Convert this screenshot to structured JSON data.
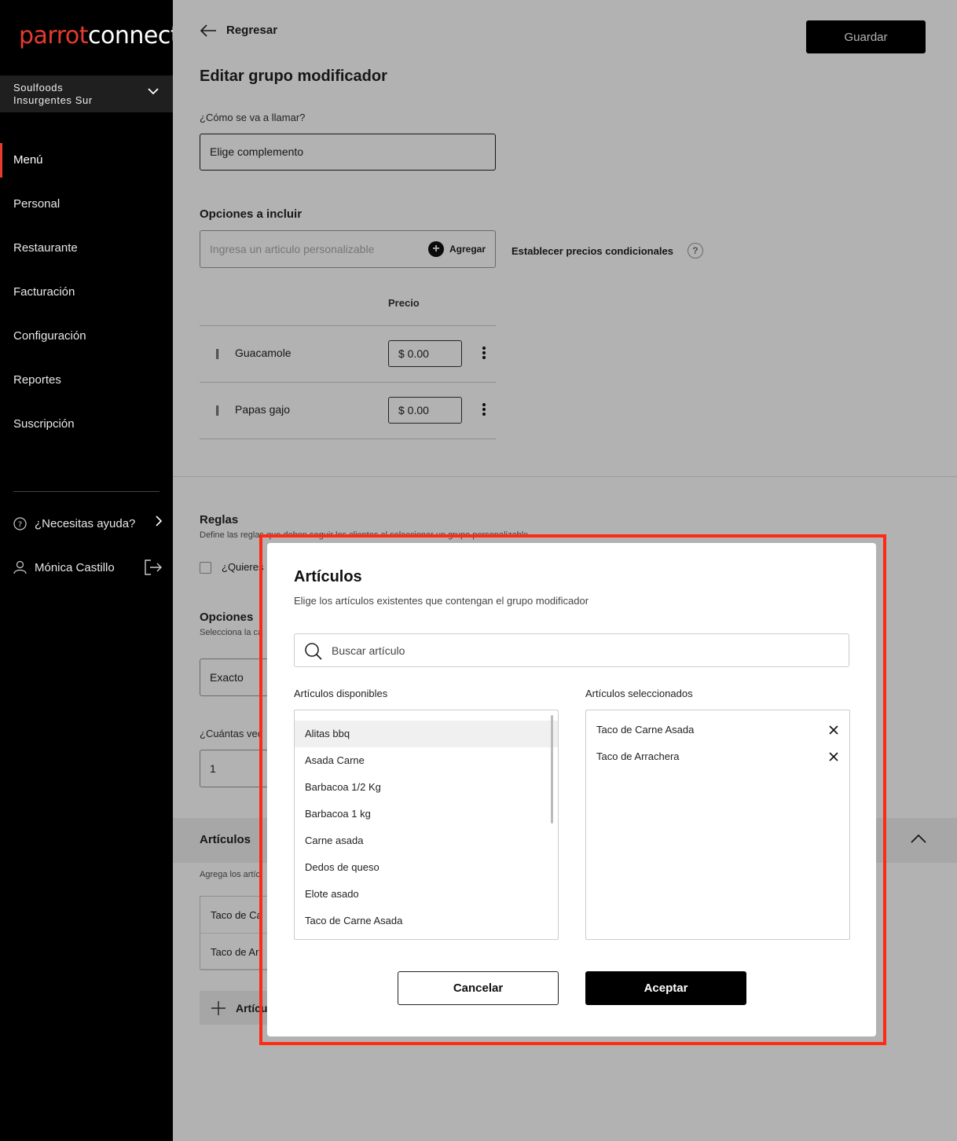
{
  "brand": {
    "part1": "parrot",
    "part2": "connect",
    "color": "#e63b2e"
  },
  "store": {
    "line1": "Soulfoods",
    "line2": "Insurgentes Sur"
  },
  "nav": {
    "items": [
      {
        "label": "Menú",
        "active": true
      },
      {
        "label": "Personal"
      },
      {
        "label": "Restaurante"
      },
      {
        "label": "Facturación"
      },
      {
        "label": "Configuración"
      },
      {
        "label": "Reportes"
      },
      {
        "label": "Suscripción"
      }
    ],
    "help": "¿Necesitas ayuda?",
    "user": "Mónica Castillo"
  },
  "header": {
    "back": "Regresar",
    "save": "Guardar"
  },
  "form": {
    "title": "Editar grupo modificador",
    "name_label": "¿Cómo se va a llamar?",
    "name_value": "Elige complemento",
    "options_title": "Opciones a incluir",
    "options_placeholder": "Ingresa un articulo personalizable",
    "add_label": "Agregar",
    "conditional_prices": "Establecer precios condicionales",
    "price_header": "Precio",
    "options": [
      {
        "name": "Guacamole",
        "price": "$ 0.00"
      },
      {
        "name": "Papas gajo",
        "price": "$ 0.00"
      }
    ]
  },
  "rules": {
    "title": "Reglas",
    "description": "Define las reglas que deben seguir los clientes al seleccionar un grupo personalizable.",
    "checkbox_label": "¿Quieres",
    "options_title": "Opciones",
    "options_desc": "Selecciona la ca",
    "select_value": "Exacto",
    "times_label": "¿Cuántas vec",
    "times_value": "1"
  },
  "articles_section": {
    "title": "Artículos",
    "desc": "Agrega los artíc",
    "items": [
      "Taco de Ca",
      "Taco de Ar"
    ],
    "add_label": "Artícu"
  },
  "modal": {
    "title": "Artículos",
    "subtitle": "Elige los artículos existentes que contengan el grupo modificador",
    "search_placeholder": "Buscar artículo",
    "available_label": "Artículos disponibles",
    "selected_label": "Artículos seleccionados",
    "available": [
      "Alitas bbq",
      "Asada Carne",
      "Barbacoa 1/2 Kg",
      "Barbacoa 1 kg",
      "Carne asada",
      "Dedos de queso",
      "Elote asado",
      "Taco de Carne Asada"
    ],
    "selected": [
      "Taco de Carne Asada",
      "Taco de Arrachera"
    ],
    "cancel": "Cancelar",
    "accept": "Aceptar",
    "highlight_color": "#ff2a14"
  }
}
